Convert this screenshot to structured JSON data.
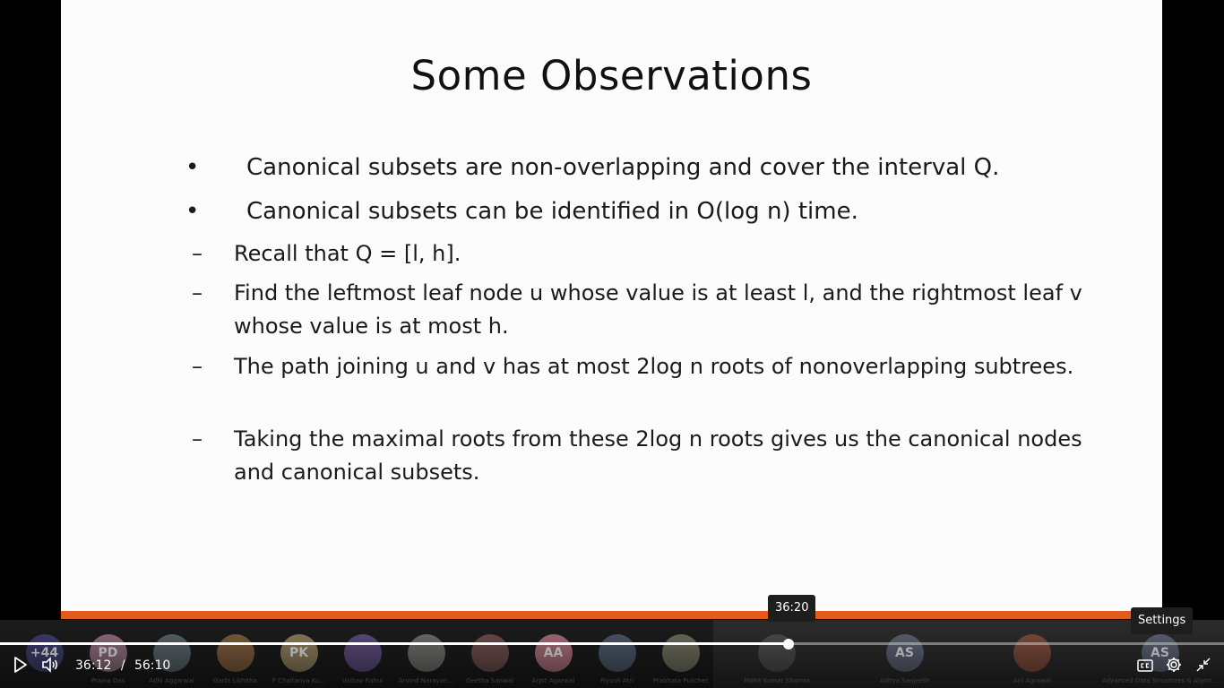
{
  "slide": {
    "title": "Some Observations",
    "bullets": [
      "Canonical subsets are non-overlapping and cover the interval Q.",
      "Canonical subsets can be identified in O(log n) time."
    ],
    "bullet_marker": "•",
    "subbullets": [
      "Recall that Q = [l, h].",
      "Find the leftmost leaf node u whose value is at least l, and the rightmost leaf v whose value is at most h.",
      "The path joining u and v has at most 2log n roots of  nonoverlapping subtrees.",
      "Taking the maximal roots from these 2log n roots gives us the canonical nodes and canonical subsets."
    ],
    "sub_marker": "–",
    "accent_color": "#e45a1c"
  },
  "participants": [
    {
      "initials": "+44",
      "name": "",
      "color": "#3b3b6a"
    },
    {
      "initials": "PD",
      "name": "Prajna Das",
      "color": "#8a6a7a"
    },
    {
      "initials": "",
      "name": "Adhi Aggarwal",
      "color": "#556066"
    },
    {
      "initials": "",
      "name": "Garbi Likhitha",
      "color": "#7a5a3a"
    },
    {
      "initials": "PK",
      "name": "P Chaitanya Ku...",
      "color": "#8a7a5a"
    },
    {
      "initials": "",
      "name": "Vaibav Rahul",
      "color": "#5a4a7a"
    },
    {
      "initials": "",
      "name": "Arvind Narayan...",
      "color": "#6a6a66"
    },
    {
      "initials": "",
      "name": "Geetha Sanwal",
      "color": "#6a4a4a"
    },
    {
      "initials": "AA",
      "name": "Arpit Agarwal",
      "color": "#a46a76"
    },
    {
      "initials": "",
      "name": "Piyush Atri",
      "color": "#4a5566"
    },
    {
      "initials": "",
      "name": "Prabhata Pulicher",
      "color": "#6a6a5a"
    },
    {
      "initials": "",
      "name": "Mohit Kumar Sharma",
      "color": "#4a4a4a"
    },
    {
      "initials": "AS",
      "name": "Aditya Sanjeeth",
      "color": "#5a6070"
    },
    {
      "initials": "",
      "name": "Ani Agrawal",
      "color": "#7a4a3a"
    },
    {
      "initials": "AS",
      "name": "Advanced Data Structures & Algori...",
      "color": "#5a6070"
    }
  ],
  "player": {
    "current_time": "36:12",
    "separator": "/",
    "duration": "56:10",
    "hover_time": "36:20",
    "settings_tooltip": "Settings",
    "progress_fraction": 0.644,
    "icons": [
      "play-icon",
      "volume-icon",
      "captions-icon",
      "settings-icon",
      "exit-fullscreen-icon"
    ]
  }
}
